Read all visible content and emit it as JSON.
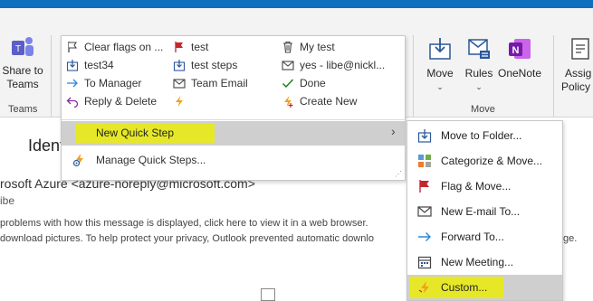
{
  "ribbon": {
    "teams": {
      "label_line1": "Share to",
      "label_line2": "Teams",
      "group": "Teams"
    },
    "move_group": {
      "move": "Move",
      "rules": "Rules",
      "onenote": "OneNote",
      "group": "Move"
    },
    "assign": {
      "line1": "Assig",
      "line2": "Policy"
    }
  },
  "quick_steps": {
    "items": [
      {
        "label": "Clear flags on ...",
        "icon": "clear-flag-icon"
      },
      {
        "label": "test",
        "icon": "red-flag-icon"
      },
      {
        "label": "My test",
        "icon": "trash-icon"
      },
      {
        "label": "test34",
        "icon": "move-folder-icon"
      },
      {
        "label": "test steps",
        "icon": "move-folder-icon"
      },
      {
        "label": "yes - libe@nickl...",
        "icon": "envelope-icon"
      },
      {
        "label": "To Manager",
        "icon": "forward-arrow-icon"
      },
      {
        "label": "Team Email",
        "icon": "envelope-icon"
      },
      {
        "label": "Done",
        "icon": "checkmark-icon"
      },
      {
        "label": "Reply & Delete",
        "icon": "reply-icon"
      },
      {
        "label": "",
        "icon": "lightning-icon"
      },
      {
        "label": "Create New",
        "icon": "create-new-icon"
      }
    ],
    "new_quick_step": "New Quick Step",
    "manage": "Manage Quick Steps..."
  },
  "submenu": {
    "items": [
      {
        "label": "Move to Folder...",
        "icon": "move-folder-icon"
      },
      {
        "label": "Categorize & Move...",
        "icon": "categorize-icon"
      },
      {
        "label": "Flag & Move...",
        "icon": "flag-icon"
      },
      {
        "label": "New E-mail To...",
        "icon": "envelope-icon"
      },
      {
        "label": "Forward To...",
        "icon": "forward-arrow-icon"
      },
      {
        "label": "New Meeting...",
        "icon": "calendar-icon"
      },
      {
        "label": "Custom...",
        "icon": "lightning-icon"
      }
    ]
  },
  "message": {
    "title": "Identity",
    "from": "rosoft Azure <azure-noreply@microsoft.com>",
    "to": "ibe",
    "info1": "problems with how this message is displayed, click here to view it in a web browser.",
    "info2": "download pictures. To help protect your privacy, Outlook prevented automatic downlo",
    "info2_tail": "ge."
  },
  "colors": {
    "highlight": "#e6e827",
    "selected_row": "#cfcfcf",
    "accent_blue": "#106ebe"
  }
}
